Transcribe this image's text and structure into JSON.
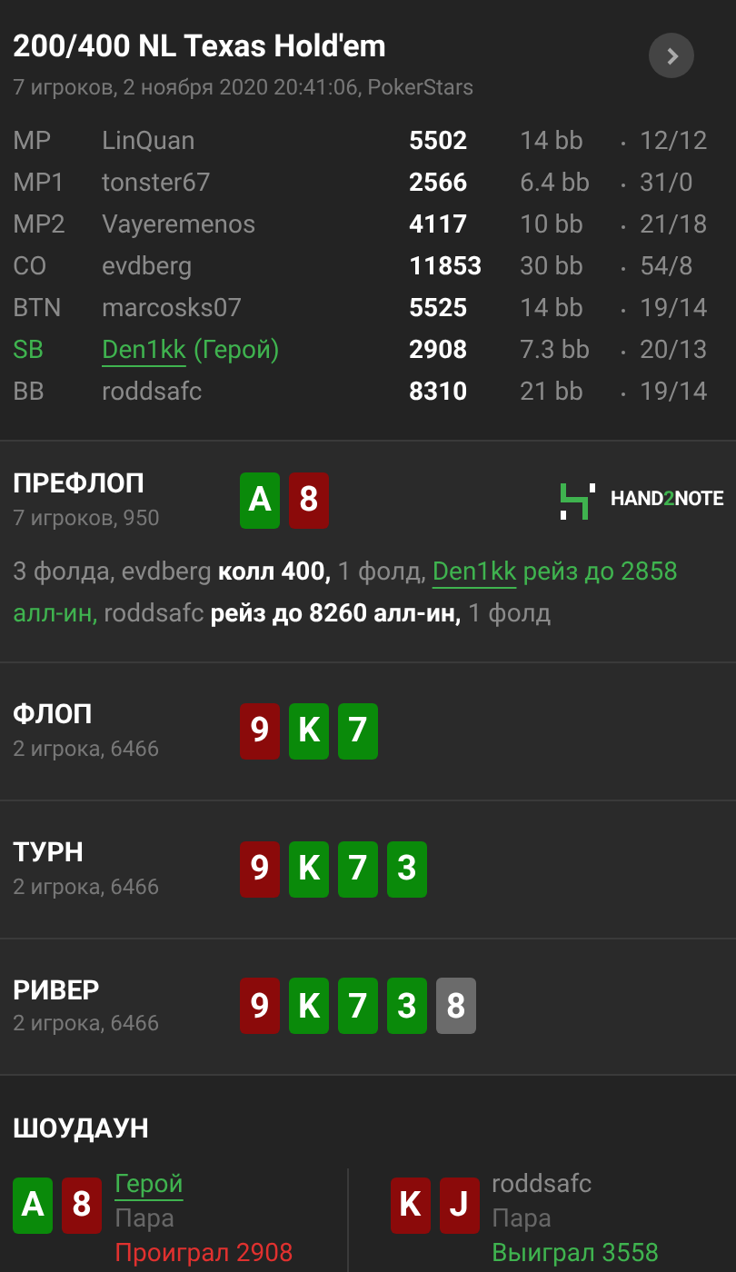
{
  "header": {
    "title": "200/400 NL Texas Hold'em",
    "subtitle": "7 игроков, 2 ноября 2020 20:41:06, PokerStars"
  },
  "players": [
    {
      "position": "MP",
      "name": "LinQuan",
      "hero": false,
      "stack": "5502",
      "bb": "14 bb",
      "stats": "12/12"
    },
    {
      "position": "MP1",
      "name": "tonster67",
      "hero": false,
      "stack": "2566",
      "bb": "6.4 bb",
      "stats": "31/0"
    },
    {
      "position": "MP2",
      "name": "Vayeremenos",
      "hero": false,
      "stack": "4117",
      "bb": "10 bb",
      "stats": "21/18"
    },
    {
      "position": "CO",
      "name": "evdberg",
      "hero": false,
      "stack": "11853",
      "bb": "30 bb",
      "stats": "54/8"
    },
    {
      "position": "BTN",
      "name": "marcosks07",
      "hero": false,
      "stack": "5525",
      "bb": "14 bb",
      "stats": "19/14"
    },
    {
      "position": "SB",
      "name": "Den1kk",
      "hero": true,
      "hero_label": "(Герой)",
      "stack": "2908",
      "bb": "7.3 bb",
      "stats": "20/13"
    },
    {
      "position": "BB",
      "name": "roddsafc",
      "hero": false,
      "stack": "8310",
      "bb": "21 bb",
      "stats": "19/14"
    }
  ],
  "streets": [
    {
      "title": "ПРЕФЛОП",
      "info": "7 игроков, 950",
      "cards": [
        {
          "rank": "A",
          "color": "#0a8a0a"
        },
        {
          "rank": "8",
          "color": "#8b0a0a"
        }
      ],
      "logo": [
        {
          "text": "HAND",
          "accent": false
        },
        {
          "text": "2",
          "accent": true
        },
        {
          "text": "NOTE",
          "accent": false
        }
      ],
      "actions": [
        {
          "text": "3 фолда, ",
          "kind": "muted"
        },
        {
          "text": "evdberg ",
          "kind": "muted"
        },
        {
          "text": "колл 400, ",
          "kind": "action"
        },
        {
          "text": "1 фолд, ",
          "kind": "muted"
        },
        {
          "text": "Den1kk",
          "kind": "hero_name"
        },
        {
          "text": " рейз до 2858 алл-ин, ",
          "kind": "hero_action"
        },
        {
          "text": "roddsafc ",
          "kind": "muted"
        },
        {
          "text": "рейз до 8260 алл-ин, ",
          "kind": "action"
        },
        {
          "text": "1 фолд",
          "kind": "muted"
        }
      ]
    },
    {
      "title": "ФЛОП",
      "info": "2 игрока, 6466",
      "cards": [
        {
          "rank": "9",
          "color": "#8b0a0a"
        },
        {
          "rank": "K",
          "color": "#0a8a0a"
        },
        {
          "rank": "7",
          "color": "#0a8a0a"
        }
      ]
    },
    {
      "title": "ТУРН",
      "info": "2 игрока, 6466",
      "cards": [
        {
          "rank": "9",
          "color": "#8b0a0a"
        },
        {
          "rank": "K",
          "color": "#0a8a0a"
        },
        {
          "rank": "7",
          "color": "#0a8a0a"
        },
        {
          "rank": "3",
          "color": "#0a8a0a"
        }
      ]
    },
    {
      "title": "РИВЕР",
      "info": "2 игрока, 6466",
      "cards": [
        {
          "rank": "9",
          "color": "#8b0a0a"
        },
        {
          "rank": "K",
          "color": "#0a8a0a"
        },
        {
          "rank": "7",
          "color": "#0a8a0a"
        },
        {
          "rank": "3",
          "color": "#0a8a0a"
        },
        {
          "rank": "8",
          "color": "#6b6b6b"
        }
      ]
    }
  ],
  "showdown": {
    "title": "ШОУДАУН",
    "hands": [
      {
        "name": "Герой",
        "hero": true,
        "hand": "Пара",
        "result": "Проиграл 2908",
        "won": false,
        "cards": [
          {
            "rank": "A",
            "color": "#0a8a0a"
          },
          {
            "rank": "8",
            "color": "#8b0a0a"
          }
        ]
      },
      {
        "name": "roddsafc",
        "hero": false,
        "hand": "Пара",
        "result": "Выиграл 3558",
        "won": true,
        "cards": [
          {
            "rank": "K",
            "color": "#8b0a0a"
          },
          {
            "rank": "J",
            "color": "#8b0a0a"
          }
        ]
      }
    ]
  }
}
